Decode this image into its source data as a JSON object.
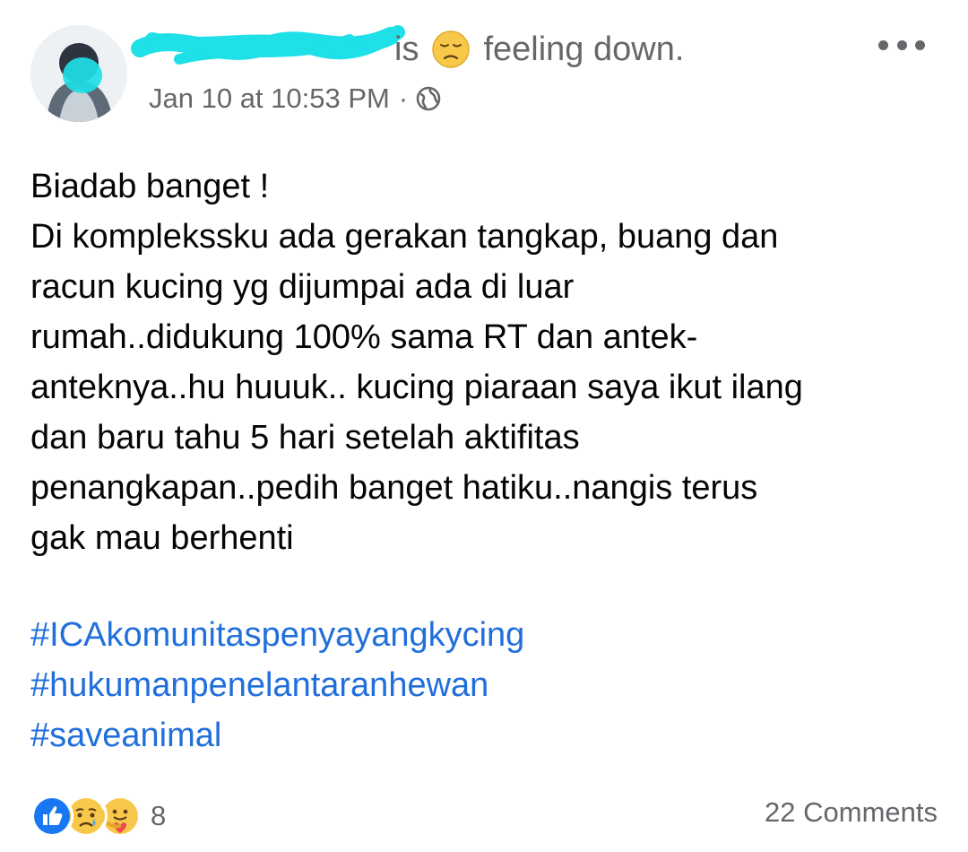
{
  "post": {
    "feeling_is": "is",
    "feeling_text": "feeling down.",
    "timestamp": "Jan 10 at 10:53 PM",
    "separator": "·",
    "privacy_icon": "globe-icon",
    "menu_icon": "more-options-icon",
    "body_lines": [
      "Biadab banget !",
      "Di komplekssku ada gerakan tangkap, buang dan",
      "racun kucing yg dijumpai ada di luar",
      "rumah..didukung 100% sama RT dan antek-",
      "anteknya..hu huuuk.. kucing piaraan saya ikut ilang",
      "dan baru tahu 5 hari setelah aktifitas",
      "penangkapan..pedih banget hatiku..nangis terus",
      "gak mau berhenti"
    ],
    "hashtags": [
      "#ICAkomunitaspenyayangkycing",
      "#hukumanpenelantaranhewan",
      "#saveanimal"
    ],
    "reaction_icons": [
      "like-reaction-icon",
      "sad-reaction-icon",
      "care-reaction-icon"
    ],
    "reaction_count": "8",
    "comments": "22 Comments"
  },
  "colors": {
    "text": "#050505",
    "secondary": "#65676b",
    "link": "#216fdb",
    "like": "#1877f2",
    "scribble": "#1ee0e6"
  }
}
